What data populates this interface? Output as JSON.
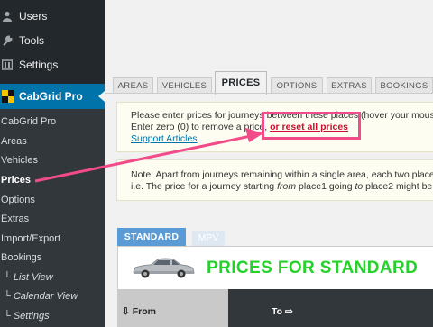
{
  "sidebar": {
    "top_items": [
      {
        "label": "Users",
        "icon": "user-icon"
      },
      {
        "label": "Tools",
        "icon": "wrench-icon"
      },
      {
        "label": "Settings",
        "icon": "settings-icon"
      }
    ],
    "plugin": {
      "label": "CabGrid Pro",
      "icon": "cabgrid-logo-icon"
    },
    "submenu": [
      {
        "label": "CabGrid Pro",
        "current": false,
        "child": false
      },
      {
        "label": "Areas",
        "current": false,
        "child": false
      },
      {
        "label": "Vehicles",
        "current": false,
        "child": false
      },
      {
        "label": "Prices",
        "current": true,
        "child": false
      },
      {
        "label": "Options",
        "current": false,
        "child": false
      },
      {
        "label": "Extras",
        "current": false,
        "child": false
      },
      {
        "label": "Import/Export",
        "current": false,
        "child": false
      },
      {
        "label": "Bookings",
        "current": false,
        "child": false
      },
      {
        "label": "└ List View",
        "current": false,
        "child": true
      },
      {
        "label": "└ Calendar View",
        "current": false,
        "child": true
      },
      {
        "label": "└ Settings",
        "current": false,
        "child": true
      }
    ]
  },
  "tabs": [
    "AREAS",
    "VEHICLES",
    "PRICES",
    "OPTIONS",
    "EXTRAS",
    "BOOKINGS"
  ],
  "active_tab": "PRICES",
  "notice1": {
    "line1": "Please enter prices for journeys between these places (hover your mouse",
    "line2_prefix": "Enter zero (0) to remove a price, ",
    "reset_link": "or reset all prices",
    "support_link": "Support Articles"
  },
  "notice2": {
    "line1": "Note: Apart from journeys remaining within a single area, each two places",
    "line2_a": "i.e. The price for a journey starting ",
    "line2_from": "from",
    "line2_b": " place1 going ",
    "line2_to": "to",
    "line2_c": " place2 might be"
  },
  "vehicle_tabs": [
    "STANDARD",
    "MPV"
  ],
  "panel": {
    "title": "PRICES FOR STANDARD",
    "col_from": "⇩ From",
    "col_to": "To ⇨"
  },
  "colors": {
    "admin_bar": "#23282d",
    "accent": "#0073aa",
    "title_green": "#27d12b",
    "highlight_pink": "#f24b8a",
    "reset_red": "#c8102e"
  }
}
